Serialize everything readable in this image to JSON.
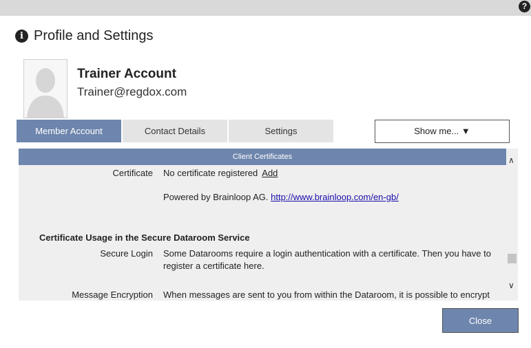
{
  "help_icon": "?",
  "dialog": {
    "title": "Profile and Settings",
    "title_icon": "i"
  },
  "account": {
    "name": "Trainer Account",
    "email": "Trainer@regdox.com"
  },
  "tabs": [
    {
      "label": "Member Account",
      "active": true
    },
    {
      "label": "Contact Details",
      "active": false
    },
    {
      "label": "Settings",
      "active": false
    }
  ],
  "show_me": {
    "label": "Show me... ▼"
  },
  "section": {
    "header": "Client Certificates",
    "certificate": {
      "label": "Certificate",
      "value": "No certificate registered",
      "action": "Add"
    },
    "powered_by": {
      "text": "Powered by Brainloop AG.",
      "url": "http://www.brainloop.com/en-gb/"
    },
    "usage_heading": "Certificate Usage in the Secure Dataroom Service",
    "secure_login": {
      "label": "Secure Login",
      "value": "Some Datarooms require a login authentication with a certificate. Then you have to register a certificate here."
    },
    "message_encryption": {
      "label": "Message Encryption",
      "value": "When messages are sent to you from within the Dataroom, it is possible to encrypt"
    }
  },
  "scroll": {
    "up": "∧",
    "down": "∨"
  },
  "colors": {
    "accent": "#6e86ad",
    "tab_inactive": "#e4e4e4",
    "panel": "#efefef"
  },
  "close_button": {
    "label": "Close"
  }
}
